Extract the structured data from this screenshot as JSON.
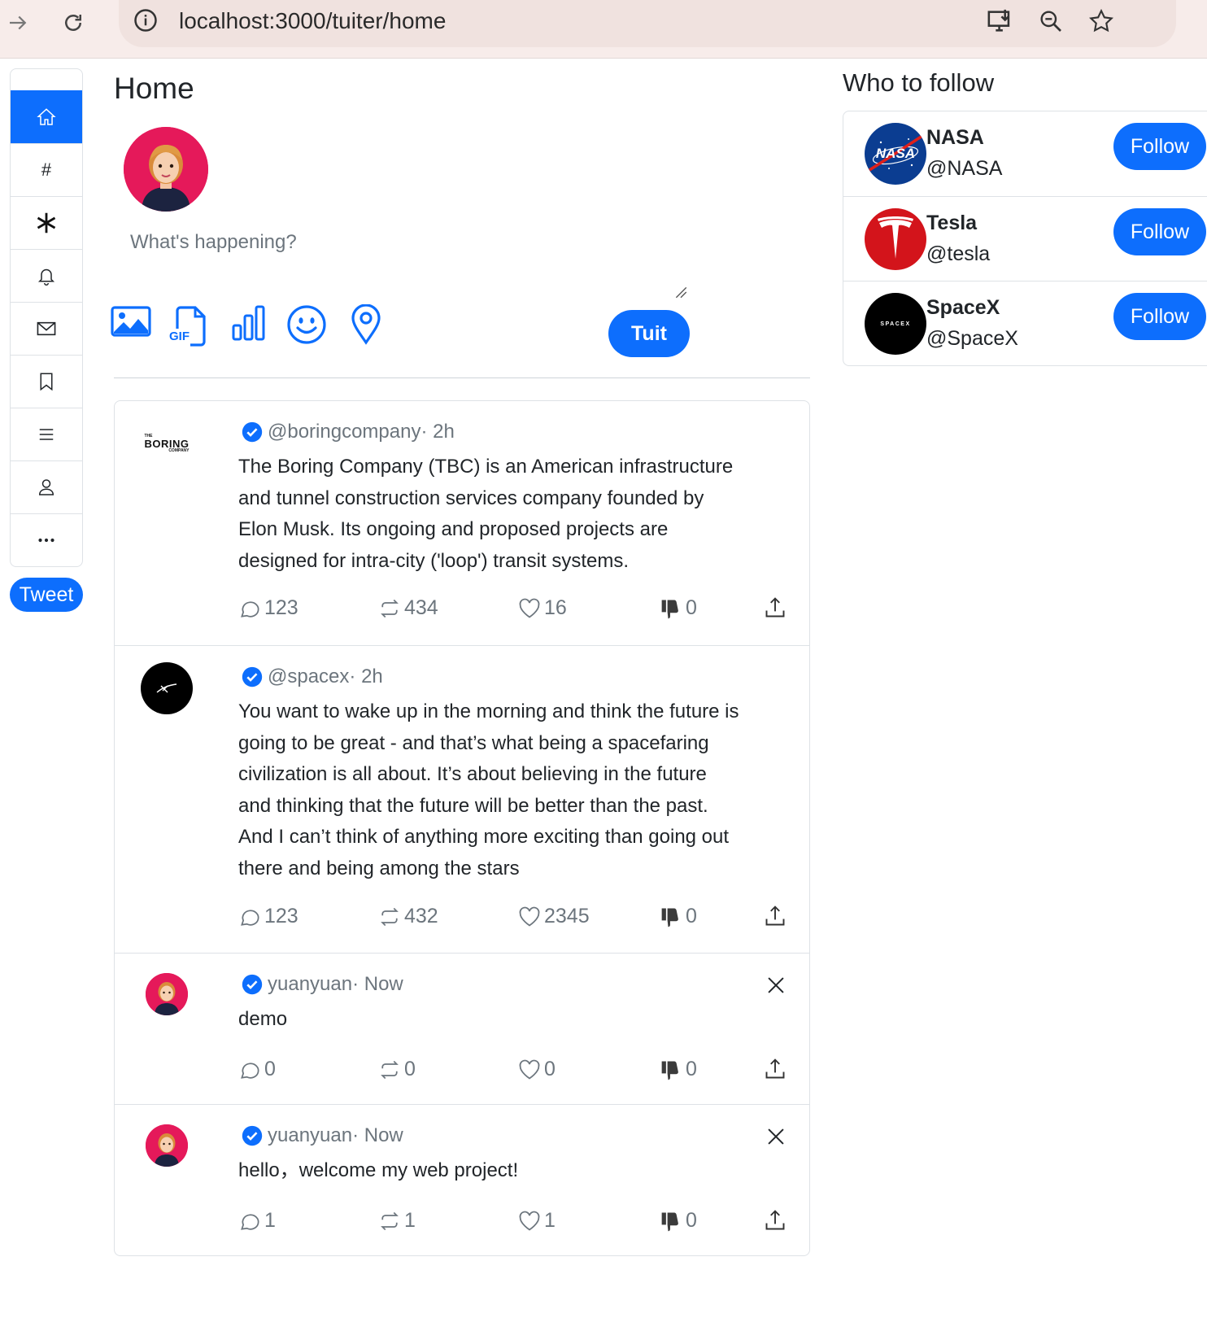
{
  "browser": {
    "url": "localhost:3000/tuiter/home"
  },
  "sidebar": {
    "items": [
      {
        "icon": "home-icon",
        "active": true
      },
      {
        "icon": "hashtag-icon",
        "glyph": "#"
      },
      {
        "icon": "asterisk-icon"
      },
      {
        "icon": "bell-icon"
      },
      {
        "icon": "envelope-icon"
      },
      {
        "icon": "bookmark-icon"
      },
      {
        "icon": "list-icon"
      },
      {
        "icon": "person-icon"
      },
      {
        "icon": "more-icon"
      }
    ],
    "tweet_label": "Tweet"
  },
  "main": {
    "title": "Home",
    "composer": {
      "placeholder": "What's happening?",
      "tools": [
        "image-icon",
        "gif-icon",
        "poll-icon",
        "emoji-icon",
        "location-icon"
      ],
      "gif_text": "GIF",
      "submit_label": "Tuit"
    },
    "posts": [
      {
        "handle": "@boringcompany",
        "time": "· 2h",
        "avatar": "boring-company-logo",
        "logo_text_small": "THE",
        "logo_text_main": "BORING",
        "logo_text_sub": "COMPANY",
        "lines": [
          "The Boring Company (TBC) is an American infrastructure",
          "and tunnel construction services company founded by",
          "Elon Musk. Its ongoing and proposed projects are",
          "designed for intra-city ('loop') transit systems."
        ],
        "replies": "123",
        "retuits": "434",
        "likes": "16",
        "dislikes": "0",
        "closable": false
      },
      {
        "handle": "@spacex",
        "time": "· 2h",
        "avatar": "spacex-logo",
        "lines": [
          "You want to wake up in the morning and think the future is",
          "going to be great - and that’s what being a spacefaring",
          "civilization is all about. It’s about believing in the future",
          "and thinking that the future will be better than the past.",
          "And I can’t think of anything more exciting than going out",
          "there and being among the stars"
        ],
        "replies": "123",
        "retuits": "432",
        "likes": "2345",
        "dislikes": "0",
        "closable": false
      },
      {
        "handle": "yuanyuan",
        "time": "· Now",
        "avatar": "user-avatar",
        "lines": [
          "demo"
        ],
        "replies": "0",
        "retuits": "0",
        "likes": "0",
        "dislikes": "0",
        "closable": true
      },
      {
        "handle": "yuanyuan",
        "time": "· Now",
        "avatar": "user-avatar",
        "lines": [
          "hello，welcome my web project!"
        ],
        "replies": "1",
        "retuits": "1",
        "likes": "1",
        "dislikes": "0",
        "closable": true
      }
    ]
  },
  "who_to_follow": {
    "title": "Who to follow",
    "follow_label": "Follow",
    "accounts": [
      {
        "name": "NASA",
        "handle": "@NASA",
        "logo": "nasa-logo",
        "logo_text": "NASA"
      },
      {
        "name": "Tesla",
        "handle": "@tesla",
        "logo": "tesla-logo"
      },
      {
        "name": "SpaceX",
        "handle": "@SpaceX",
        "logo": "spacex-logo",
        "logo_text": "SPACEX"
      }
    ]
  },
  "colors": {
    "accent": "#0d6efd",
    "avatar_bg": "#e5195a",
    "tesla_red": "#d3141b",
    "nasa_blue": "#0b3d91"
  }
}
